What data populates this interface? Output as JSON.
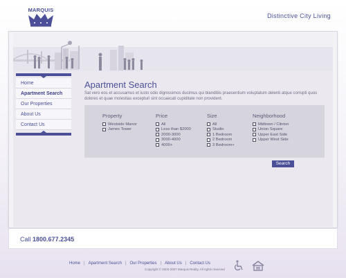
{
  "brand": {
    "logo_text": "MARQUIS",
    "logo_icon": "crown-icon",
    "tagline": "Distinctive City Living"
  },
  "nav": {
    "items": [
      {
        "label": "Home",
        "active": false
      },
      {
        "label": "Apartment Search",
        "active": true
      },
      {
        "label": "Our Properties",
        "active": false
      },
      {
        "label": "About Us",
        "active": false
      },
      {
        "label": "Contact Us",
        "active": false
      }
    ]
  },
  "main": {
    "title": "Apartment Search",
    "intro": "Sat vero eos et accusamus et iusto odio dignissimos ducimus qui blanditiis praesentium voluptatum delenti atque corrupti quos dolores et quae molestias excepturi sint occaecati cupiditate non provident.",
    "filters": {
      "property": {
        "heading": "Property",
        "options": [
          "Westside Manor",
          "James Tower"
        ]
      },
      "price": {
        "heading": "Price",
        "options": [
          "All",
          "Less than $2000",
          "2000-3000",
          "3000-4000",
          "4000+"
        ]
      },
      "size": {
        "heading": "Size",
        "options": [
          "All",
          "Studio",
          "1 Bedroom",
          "2 Bedroom",
          "3 Bedroom+"
        ]
      },
      "neighborhood": {
        "heading": "Neighborhood",
        "options": [
          "Midtown / Clinton",
          "Union Square",
          "Upper East Side",
          "Upper West Side"
        ]
      }
    },
    "search_button": "Search"
  },
  "callbar": {
    "label": "Call",
    "phone": "1800.677.2345"
  },
  "footer": {
    "links": [
      "Home",
      "Apartment Search",
      "Our Properties",
      "About Us",
      "Contact Us"
    ],
    "copyright": "Copyright © 2003-2007 Marquis Realty. All rights reserved",
    "icons": [
      "wheelchair-accessibility-icon",
      "equal-housing-icon"
    ]
  },
  "colors": {
    "brand": "#4a4f97",
    "panel": "#d6d5de"
  }
}
